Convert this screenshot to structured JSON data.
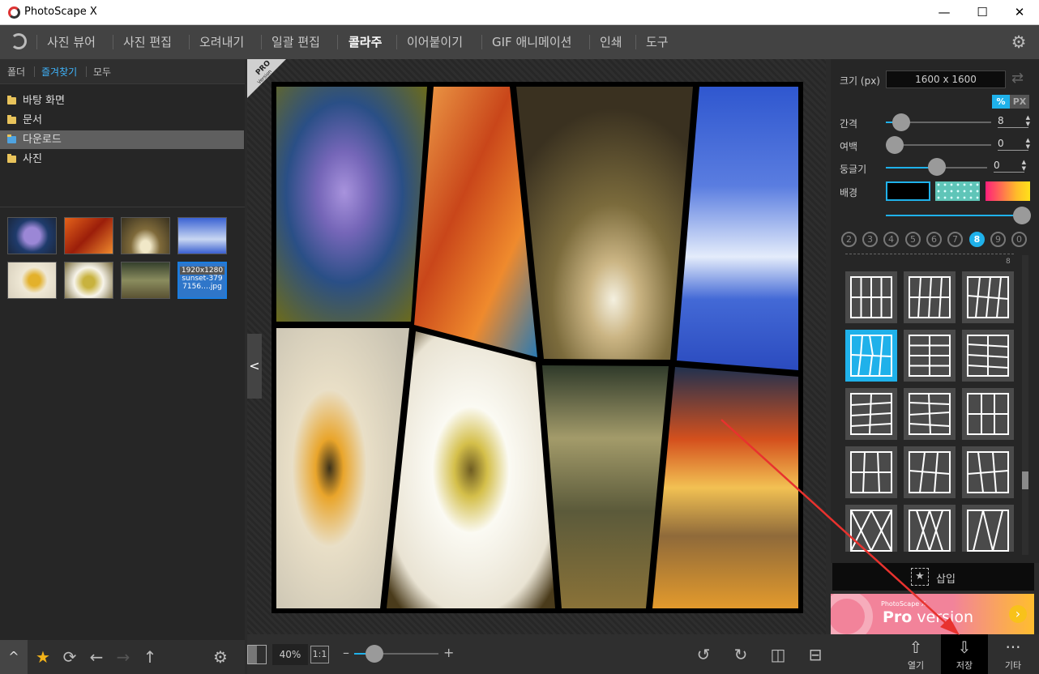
{
  "window": {
    "title": "PhotoScape X",
    "min": "—",
    "max": "☐",
    "close": "✕"
  },
  "nav": {
    "tabs": [
      "사진 뷰어",
      "사진 편집",
      "오려내기",
      "일괄 편집",
      "콜라주",
      "이어붙이기",
      "GIF 애니메이션",
      "인쇄",
      "도구"
    ],
    "active": "콜라주"
  },
  "left": {
    "tabs": [
      "폴더",
      "즐겨찾기",
      "모두"
    ],
    "folders": [
      "바탕 화면",
      "문서",
      "다운로드",
      "사진"
    ],
    "selected_folder": "다운로드",
    "selected_thumb": {
      "dims": "1920x1280",
      "name1": "sunset-379",
      "name2": "7156….jpg"
    }
  },
  "pro_badge": {
    "line1": "PRO",
    "line2": "Version"
  },
  "right": {
    "size_label": "크기 (px)",
    "size_value": "1600 x 1600",
    "unit_pct": "%",
    "unit_px": "PX",
    "spacing_label": "간격",
    "spacing_value": "8",
    "margin_label": "여백",
    "margin_value": "0",
    "round_label": "둥글기",
    "round_value": "0",
    "background_label": "배경",
    "grid_counts": [
      "2",
      "3",
      "4",
      "5",
      "6",
      "7",
      "8",
      "9",
      "0"
    ],
    "active_count": "8",
    "section_count": "8",
    "insert_label": "삽입"
  },
  "ad": {
    "small": "PhotoScape X",
    "big_bold": "Pro",
    "big_rest": " version"
  },
  "bottom": {
    "zoom": "40%",
    "one_to_one": "1:1",
    "open": "열기",
    "save": "저장",
    "more": "기타"
  },
  "colors": {
    "accent": "#1fb1ea",
    "bg": "#2b2b2b"
  }
}
